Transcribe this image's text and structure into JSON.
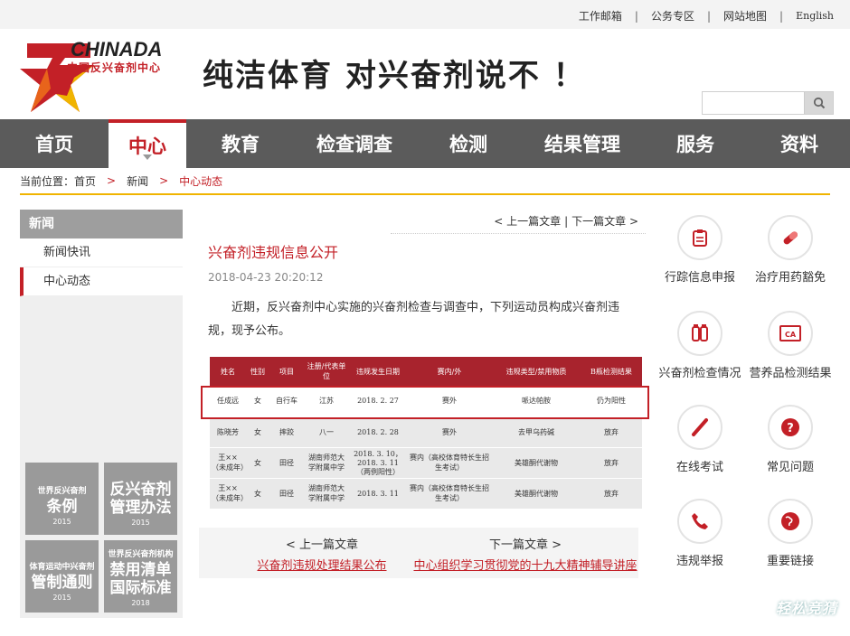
{
  "top_links": [
    "工作邮箱",
    "公务专区",
    "网站地图",
    "English"
  ],
  "logo": {
    "en": "CHINADA",
    "cn": "中国反兴奋剂中心"
  },
  "slogan": "纯洁体育  对兴奋剂说不 ！",
  "search": {
    "placeholder": ""
  },
  "nav": [
    {
      "label": "首页",
      "active": false
    },
    {
      "label": "中心",
      "active": true
    },
    {
      "label": "教育",
      "active": false
    },
    {
      "label": "检查调查",
      "active": false
    },
    {
      "label": "检测",
      "active": false
    },
    {
      "label": "结果管理",
      "active": false
    },
    {
      "label": "服务",
      "active": false
    },
    {
      "label": "资料",
      "active": false
    }
  ],
  "breadcrumb": {
    "prefix": "当前位置：",
    "items": [
      "首页",
      "新闻",
      "中心动态"
    ]
  },
  "sidebar": {
    "title": "新闻",
    "items": [
      {
        "label": "新闻快讯",
        "active": false
      },
      {
        "label": "中心动态",
        "active": true
      }
    ]
  },
  "tiles": [
    {
      "t1": "世界反兴奋剂",
      "t2": "条例",
      "t3": "2015"
    },
    {
      "t1": "",
      "t2": "反兴奋剂管理办法",
      "t3": "2015"
    },
    {
      "t1": "体育运动中兴奋剂",
      "t2": "管制通则",
      "t3": "2015"
    },
    {
      "t1": "世界反兴奋剂机构",
      "t2": "禁用清单国际标准",
      "t3": "2018"
    }
  ],
  "article": {
    "prev_label": "< 上一篇文章",
    "next_label": "下一篇文章 >",
    "title": "兴奋剂违规信息公开",
    "date": "2018-04-23 20:20:12",
    "body": "近期，反兴奋剂中心实施的兴奋剂检查与调查中，下列运动员构成兴奋剂违规，现予公布。"
  },
  "table": {
    "headers": [
      "姓名",
      "性别",
      "项目",
      "注册/代表单位",
      "违规发生日期",
      "赛内/外",
      "违规类型/禁用物质",
      "B瓶检测结果"
    ],
    "rows": [
      [
        "任成远",
        "女",
        "自行车",
        "江苏",
        "2018. 2. 27",
        "赛外",
        "哌达帕胺",
        "仍为阳性"
      ],
      [
        "陈晓芳",
        "女",
        "摔跤",
        "八一",
        "2018. 2. 28",
        "赛外",
        "去甲乌药碱",
        "放弃"
      ],
      [
        "王××（未成年）",
        "女",
        "田径",
        "湖南师范大学附属中学",
        "2018. 3. 10，2018. 3. 11（两例阳性）",
        "赛内（高校体育特长生招生考试）",
        "美雄酮代谢物",
        "放弃"
      ],
      [
        "王××（未成年）",
        "女",
        "田径",
        "湖南师范大学附属中学",
        "2018. 3. 11",
        "赛内（高校体育特长生招生考试）",
        "美雄酮代谢物",
        "放弃"
      ]
    ]
  },
  "prevnext": {
    "prev": {
      "label": "< 上一篇文章",
      "link": "兴奋剂违规处理结果公布"
    },
    "next": {
      "label": "下一篇文章 >",
      "link": "中心组织学习贯彻党的十九大精神辅导讲座"
    }
  },
  "services": [
    {
      "label": "行踪信息申报",
      "icon": "clipboard-icon"
    },
    {
      "label": "治疗用药豁免",
      "icon": "pill-icon"
    },
    {
      "label": "兴奋剂检查情况",
      "icon": "sample-bottles-icon"
    },
    {
      "label": "营养品检测结果",
      "icon": "ca-badge-icon"
    },
    {
      "label": "在线考试",
      "icon": "pen-icon"
    },
    {
      "label": "常见问题",
      "icon": "question-icon"
    },
    {
      "label": "违规举报",
      "icon": "phone-icon"
    },
    {
      "label": "重要链接",
      "icon": "globe-icon"
    }
  ],
  "watermark": "轻松竞猜",
  "colors": {
    "brand_red": "#c32027",
    "nav_bg": "#5b5b5b",
    "accent_yellow": "#f0b400",
    "table_head": "#a8232d"
  }
}
